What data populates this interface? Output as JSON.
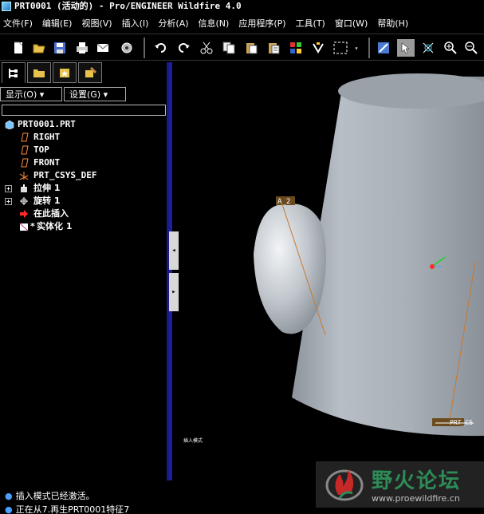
{
  "window": {
    "title": "PRT0001 (活动的) - Pro/ENGINEER Wildfire 4.0"
  },
  "menu": [
    "文件(F)",
    "编辑(E)",
    "视图(V)",
    "插入(I)",
    "分析(A)",
    "信息(N)",
    "应用程序(P)",
    "工具(T)",
    "窗口(W)",
    "帮助(H)"
  ],
  "toolbar_icons": [
    "new-icon",
    "open-icon",
    "save-icon",
    "print-icon",
    "email-icon",
    "disk-icon",
    "undo-icon",
    "redo-icon",
    "cut-icon",
    "copy-icon",
    "paste-icon",
    "paste-special-icon",
    "regenerate-icon",
    "regen-manager-icon",
    "select-box-icon",
    "model-icon",
    "select-icon",
    "datum-icon",
    "zoom-in-icon",
    "zoom-out-icon"
  ],
  "left_panel": {
    "display_dropdown": "显示(O) ▾",
    "settings_dropdown": "设置(G) ▾"
  },
  "tree": {
    "root": "PRT0001.PRT",
    "items": [
      {
        "label": "RIGHT"
      },
      {
        "label": "TOP"
      },
      {
        "label": "FRONT"
      },
      {
        "label": "PRT_CSYS_DEF"
      },
      {
        "label": "拉伸 1"
      },
      {
        "label": "旋转 1"
      },
      {
        "label": "在此插入"
      },
      {
        "label": "实体化 1"
      }
    ]
  },
  "graphics": {
    "axis_label": "A_2",
    "csys_label": "PRT_CS",
    "insert_label": "插入模式",
    "splitter_left": "◂",
    "splitter_right": "▸"
  },
  "status": {
    "line1": "插入模式已经激活。",
    "line2": "正在从7.再生PRT0001特征7"
  },
  "watermark": {
    "title": "野火论坛",
    "url": "www.proewildfire.cn"
  }
}
